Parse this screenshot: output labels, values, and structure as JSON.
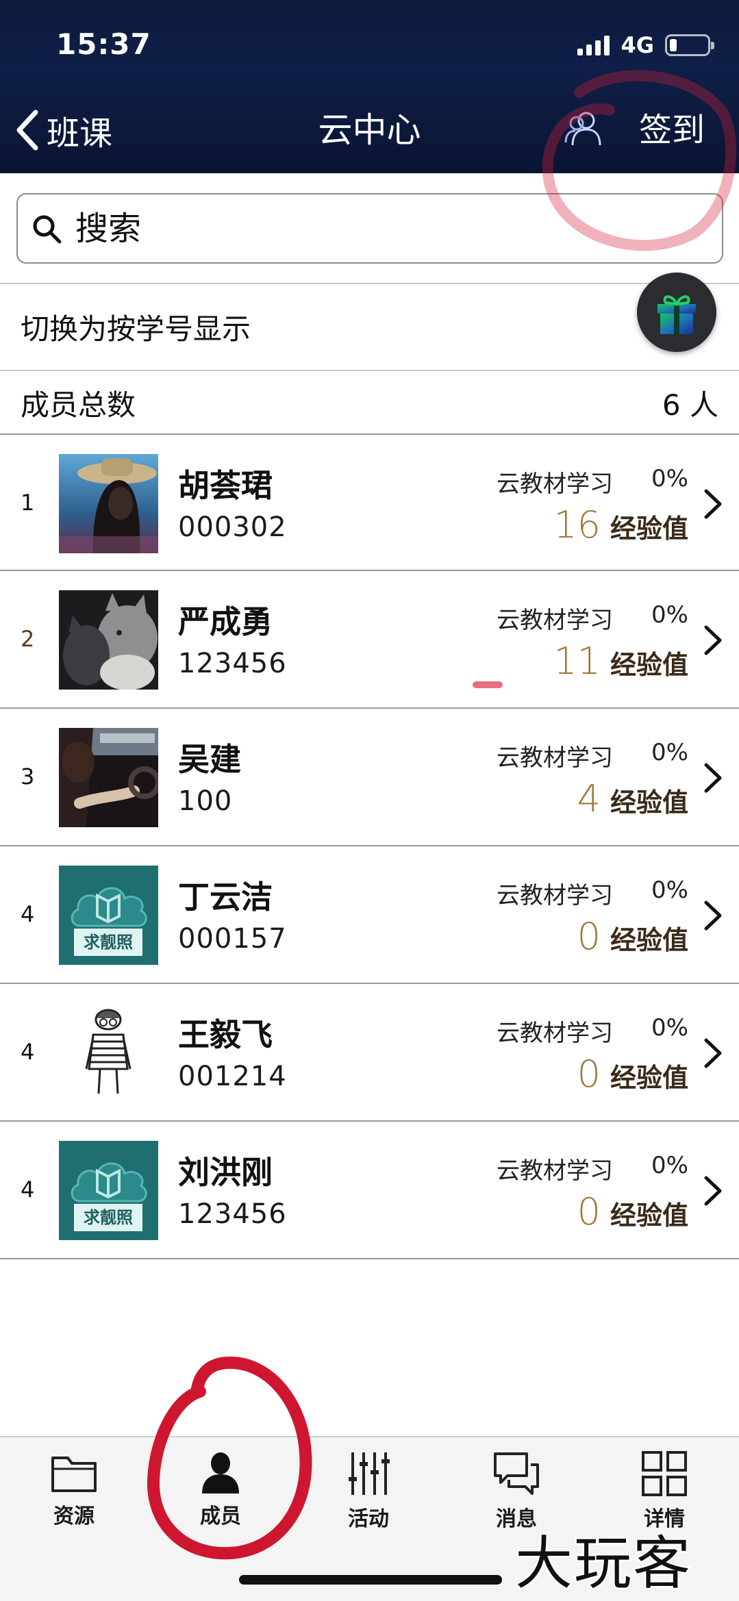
{
  "status_bar": {
    "time": "15:37",
    "network": "4G"
  },
  "nav": {
    "back_label": "班课",
    "title": "云中心",
    "checkin_label": "签到"
  },
  "search": {
    "placeholder": "搜索"
  },
  "toggle": {
    "label": "切换为按学号显示"
  },
  "summary": {
    "label": "成员总数",
    "count": "6 人"
  },
  "members": [
    {
      "rank": "1",
      "name": "胡荟珺",
      "id": "000302",
      "study_label": "云教材学习",
      "percent": "0%",
      "exp": "16",
      "exp_label": "经验值",
      "avatar": "photo-woman-hat"
    },
    {
      "rank": "2",
      "name": "严成勇",
      "id": "123456",
      "study_label": "云教材学习",
      "percent": "0%",
      "exp": "11",
      "exp_label": "经验值",
      "avatar": "photo-cat"
    },
    {
      "rank": "3",
      "name": "吴建",
      "id": "100",
      "study_label": "云教材学习",
      "percent": "0%",
      "exp": "4",
      "exp_label": "经验值",
      "avatar": "photo-driver"
    },
    {
      "rank": "4",
      "name": "丁云洁",
      "id": "000157",
      "study_label": "云教材学习",
      "percent": "0%",
      "exp": "0",
      "exp_label": "经验值",
      "avatar": "default-book-cloud",
      "avatar_text": "求靓照"
    },
    {
      "rank": "4",
      "name": "王毅飞",
      "id": "001214",
      "study_label": "云教材学习",
      "percent": "0%",
      "exp": "0",
      "exp_label": "经验值",
      "avatar": "sketch-person"
    },
    {
      "rank": "4",
      "name": "刘洪刚",
      "id": "123456",
      "study_label": "云教材学习",
      "percent": "0%",
      "exp": "0",
      "exp_label": "经验值",
      "avatar": "default-book-cloud",
      "avatar_text": "求靓照"
    }
  ],
  "tabs": [
    {
      "label": "资源",
      "icon": "folder-icon"
    },
    {
      "label": "成员",
      "icon": "person-icon",
      "active": true
    },
    {
      "label": "活动",
      "icon": "sliders-icon"
    },
    {
      "label": "消息",
      "icon": "chat-icon"
    },
    {
      "label": "详情",
      "icon": "grid-icon"
    }
  ],
  "watermark": "大玩客",
  "colors": {
    "header_bg": "#0f1f47",
    "exp_number": "#a3783a",
    "annotation_red": "#d8203a",
    "default_avatar_bg": "#1f6f70"
  }
}
